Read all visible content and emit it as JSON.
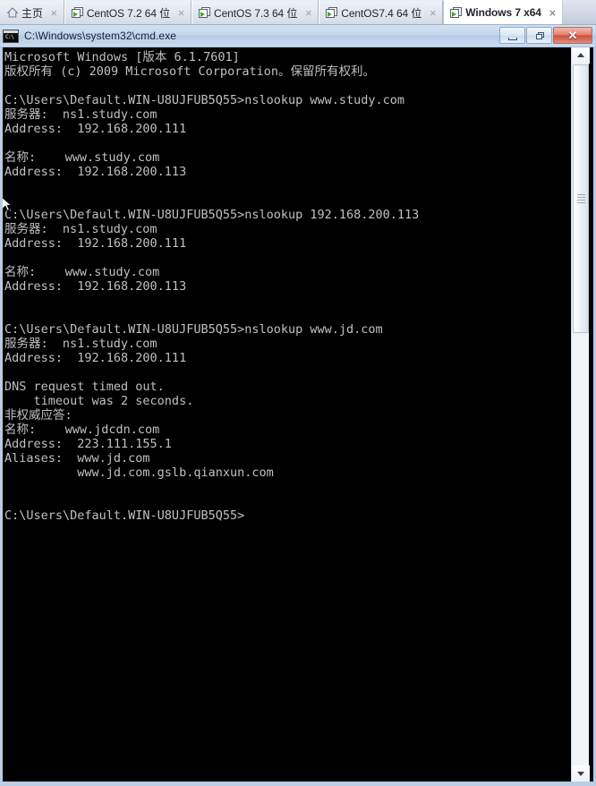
{
  "tabs": [
    {
      "label": "主页",
      "icon": "home-icon",
      "active": false,
      "close": "×"
    },
    {
      "label": "CentOS 7.2 64 位",
      "icon": "vm-icon",
      "active": false,
      "close": "×"
    },
    {
      "label": "CentOS 7.3 64 位",
      "icon": "vm-icon",
      "active": false,
      "close": "×"
    },
    {
      "label": "CentOS7.4  64 位",
      "icon": "vm-icon",
      "active": false,
      "close": "×"
    },
    {
      "label": "Windows 7 x64",
      "icon": "vm-icon",
      "active": true,
      "close": "×"
    }
  ],
  "window": {
    "title": "C:\\Windows\\system32\\cmd.exe",
    "icon": "cmd-icon",
    "minimize_label": "",
    "maximize_label": "",
    "close_label": "✕"
  },
  "console": {
    "foreground": "#c0c0c0",
    "background": "#000000",
    "lines": [
      "Microsoft Windows [版本 6.1.7601]",
      "版权所有 (c) 2009 Microsoft Corporation。保留所有权利。",
      "",
      "C:\\Users\\Default.WIN-U8UJFUB5Q55>nslookup www.study.com",
      "服务器:  ns1.study.com",
      "Address:  192.168.200.111",
      "",
      "名称:    www.study.com",
      "Address:  192.168.200.113",
      "",
      "",
      "C:\\Users\\Default.WIN-U8UJFUB5Q55>nslookup 192.168.200.113",
      "服务器:  ns1.study.com",
      "Address:  192.168.200.111",
      "",
      "名称:    www.study.com",
      "Address:  192.168.200.113",
      "",
      "",
      "C:\\Users\\Default.WIN-U8UJFUB5Q55>nslookup www.jd.com",
      "服务器:  ns1.study.com",
      "Address:  192.168.200.111",
      "",
      "DNS request timed out.",
      "    timeout was 2 seconds.",
      "非权威应答:",
      "名称:    www.jdcdn.com",
      "Address:  223.111.155.1",
      "Aliases:  www.jd.com",
      "          www.jd.com.gslb.qianxun.com",
      "",
      "",
      "C:\\Users\\Default.WIN-U8UJFUB5Q55>"
    ]
  },
  "scrollbar": {
    "orientation": "vertical",
    "up_arrow": "▲",
    "down_arrow": "▼"
  }
}
